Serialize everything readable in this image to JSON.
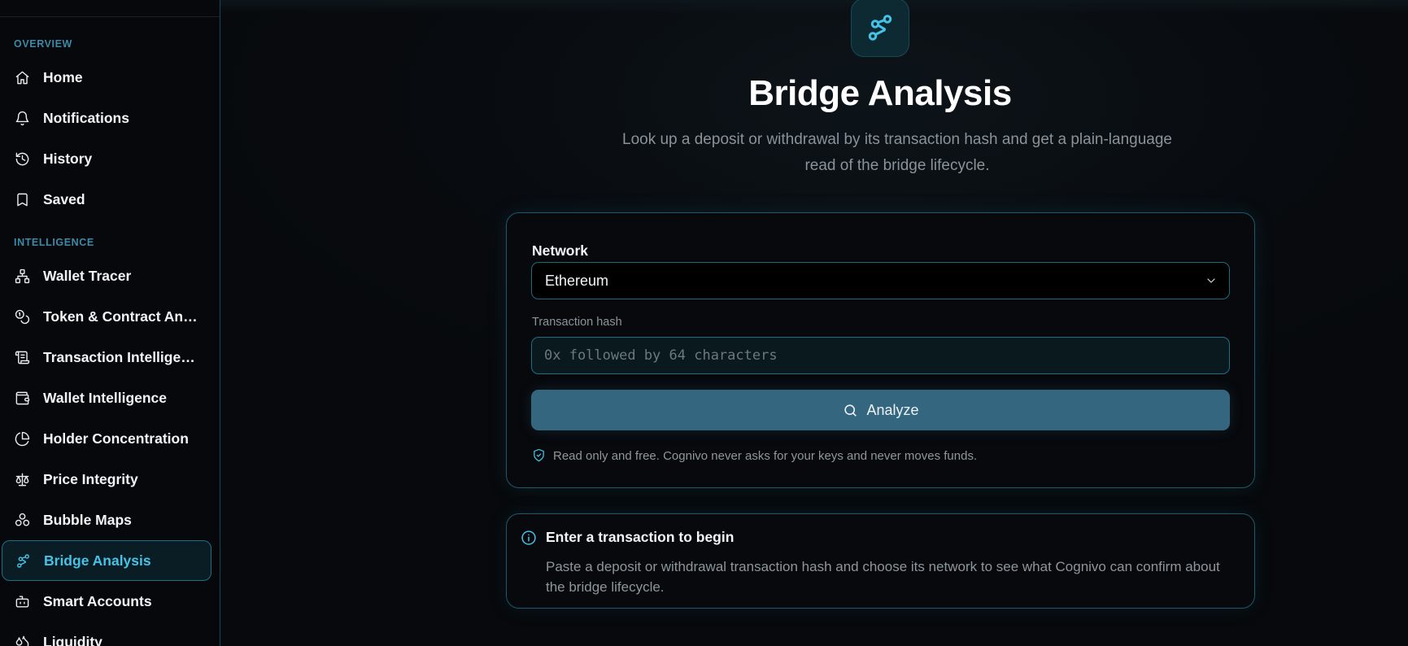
{
  "sidebar": {
    "sections": [
      {
        "label": "OVERVIEW",
        "items": [
          {
            "label": "Home",
            "icon": "home-icon"
          },
          {
            "label": "Notifications",
            "icon": "bell-icon"
          },
          {
            "label": "History",
            "icon": "history-icon"
          },
          {
            "label": "Saved",
            "icon": "bookmark-icon"
          }
        ]
      },
      {
        "label": "INTELLIGENCE",
        "items": [
          {
            "label": "Wallet Tracer",
            "icon": "network-icon"
          },
          {
            "label": "Token & Contract Anal…",
            "icon": "coins-icon"
          },
          {
            "label": "Transaction Intelligen…",
            "icon": "scroll-icon"
          },
          {
            "label": "Wallet Intelligence",
            "icon": "wallet-icon"
          },
          {
            "label": "Holder Concentration",
            "icon": "pie-chart-icon"
          },
          {
            "label": "Price Integrity",
            "icon": "scale-icon"
          },
          {
            "label": "Bubble Maps",
            "icon": "bubbles-icon"
          },
          {
            "label": "Bridge Analysis",
            "icon": "route-icon",
            "active": true
          },
          {
            "label": "Smart Accounts",
            "icon": "bot-icon"
          },
          {
            "label": "Liquidity",
            "icon": "droplets-icon"
          }
        ]
      }
    ]
  },
  "main": {
    "hero_icon": "route-icon",
    "title": "Bridge Analysis",
    "subtitle": "Look up a deposit or withdrawal by its transaction hash and get a plain-language read of the bridge lifecycle."
  },
  "form": {
    "network_label": "Network",
    "network_value": "Ethereum",
    "hash_label": "Transaction hash",
    "hash_value": "",
    "hash_placeholder": "0x followed by 64 characters",
    "analyze_label": "Analyze",
    "footnote": "Read only and free. Cognivo never asks for your keys and never moves funds."
  },
  "info": {
    "title": "Enter a transaction to begin",
    "body": "Paste a deposit or withdrawal transaction hash and choose its network to see what Cognivo can confirm about the bridge lifecycle."
  },
  "colors": {
    "accent": "#46c2e6",
    "button": "#346680",
    "section_label": "#3c8aa8",
    "border": "#1a5a6b"
  }
}
